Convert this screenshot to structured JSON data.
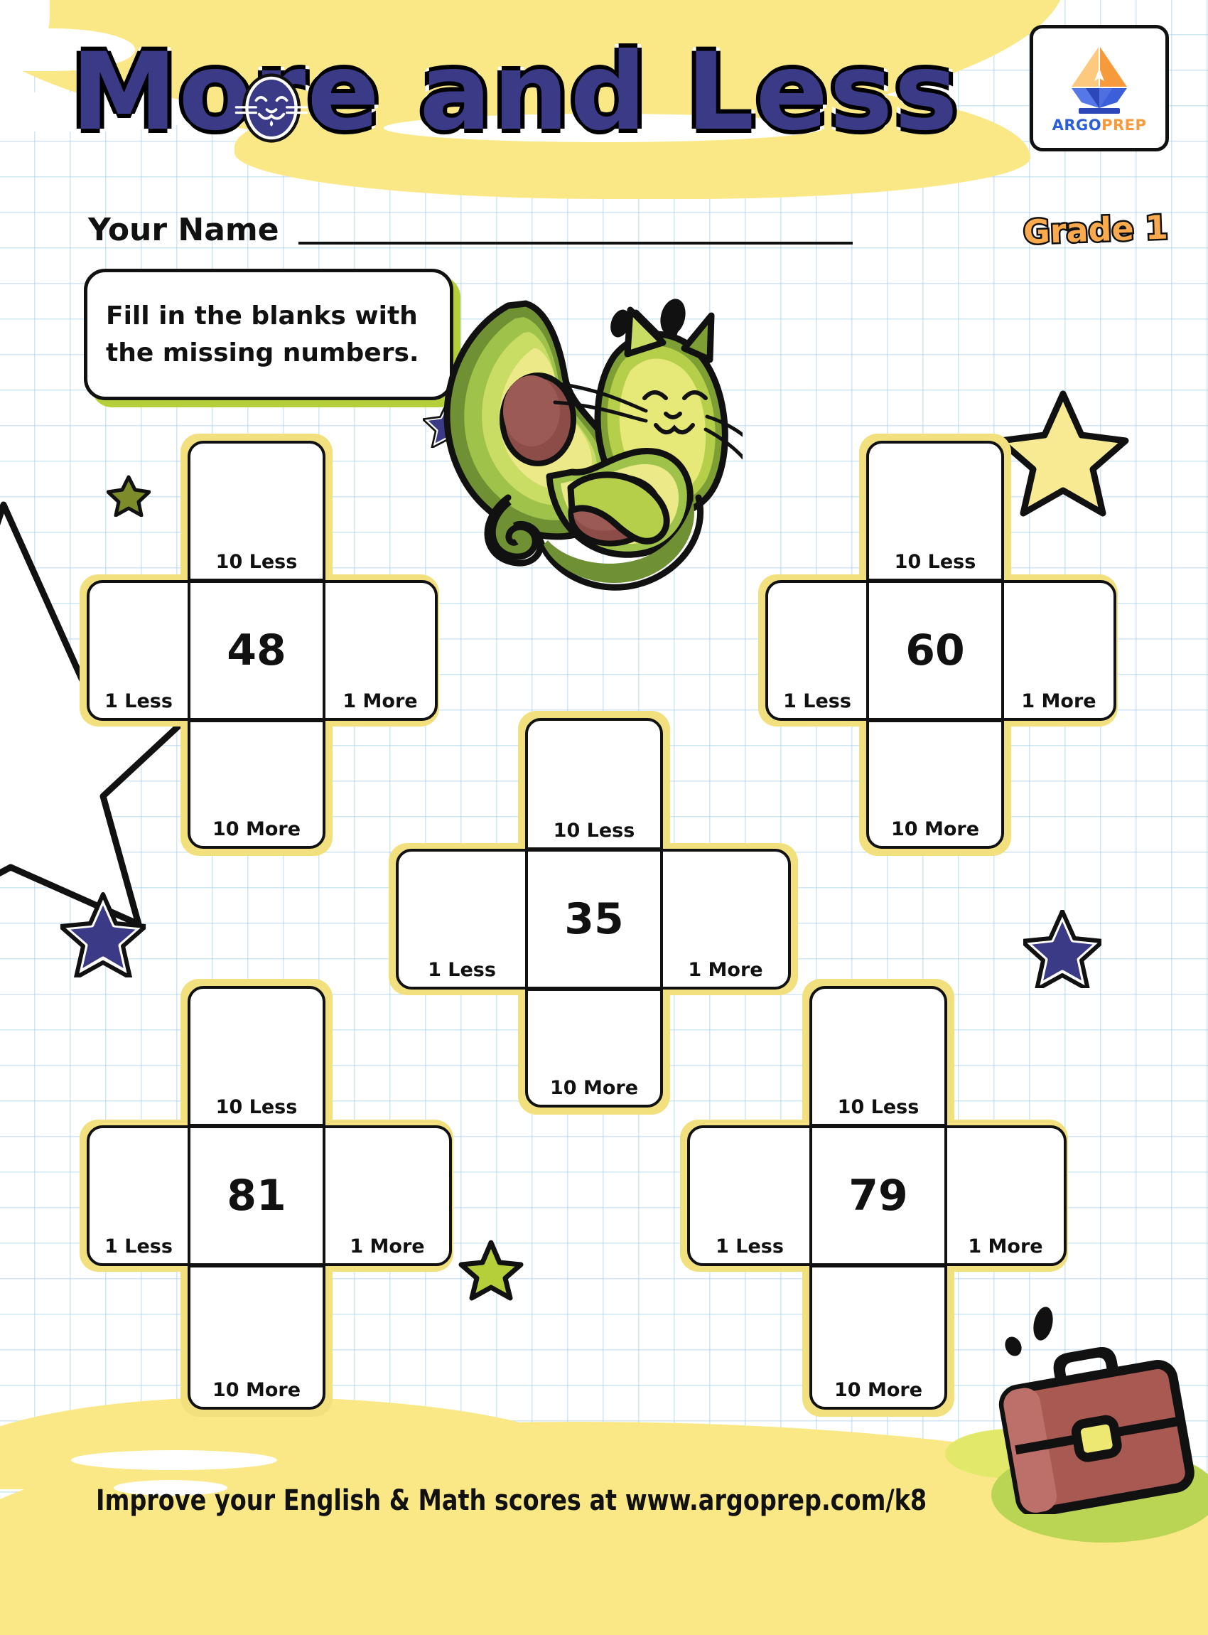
{
  "page": {
    "title": "More and Less",
    "grade": "Grade 1",
    "name_label": "Your Name",
    "instruction": "Fill in the blanks with the missing numbers.",
    "footer": "Improve your English & Math scores at www.argoprep.com/k8"
  },
  "logo": {
    "brand_argo": "ARGO",
    "brand_prep": "PREP",
    "icon": "sailboat-pen-icon"
  },
  "colors": {
    "title_fill": "#3b3a87",
    "accent_yellow": "#f9e885",
    "cell_halo": "#f2e07e",
    "instruction_border": "#b4cf3a",
    "grade_orange": "#f9a94e",
    "star_navy": "#3b3a87",
    "star_olive": "#7d8b2b",
    "star_lime": "#b4cf3a",
    "star_yellow": "#f7ea92",
    "briefcase": "#a85a52"
  },
  "labels": {
    "ten_less": "10 Less",
    "one_less": "1 Less",
    "one_more": "1 More",
    "ten_more": "10 More"
  },
  "chart_data": {
    "type": "table",
    "title": "More and Less",
    "problems": [
      {
        "id": 1,
        "center": "48",
        "ten_less": "",
        "one_less": "",
        "one_more": "",
        "ten_more": ""
      },
      {
        "id": 2,
        "center": "60",
        "ten_less": "",
        "one_less": "",
        "one_more": "",
        "ten_more": ""
      },
      {
        "id": 3,
        "center": "35",
        "ten_less": "",
        "one_less": "",
        "one_more": "",
        "ten_more": ""
      },
      {
        "id": 4,
        "center": "81",
        "ten_less": "",
        "one_less": "",
        "one_more": "",
        "ten_more": ""
      },
      {
        "id": 5,
        "center": "79",
        "ten_less": "",
        "one_less": "",
        "one_more": "",
        "ten_more": ""
      }
    ]
  },
  "problems": [
    {
      "center": "48"
    },
    {
      "center": "60"
    },
    {
      "center": "35"
    },
    {
      "center": "81"
    },
    {
      "center": "79"
    }
  ]
}
